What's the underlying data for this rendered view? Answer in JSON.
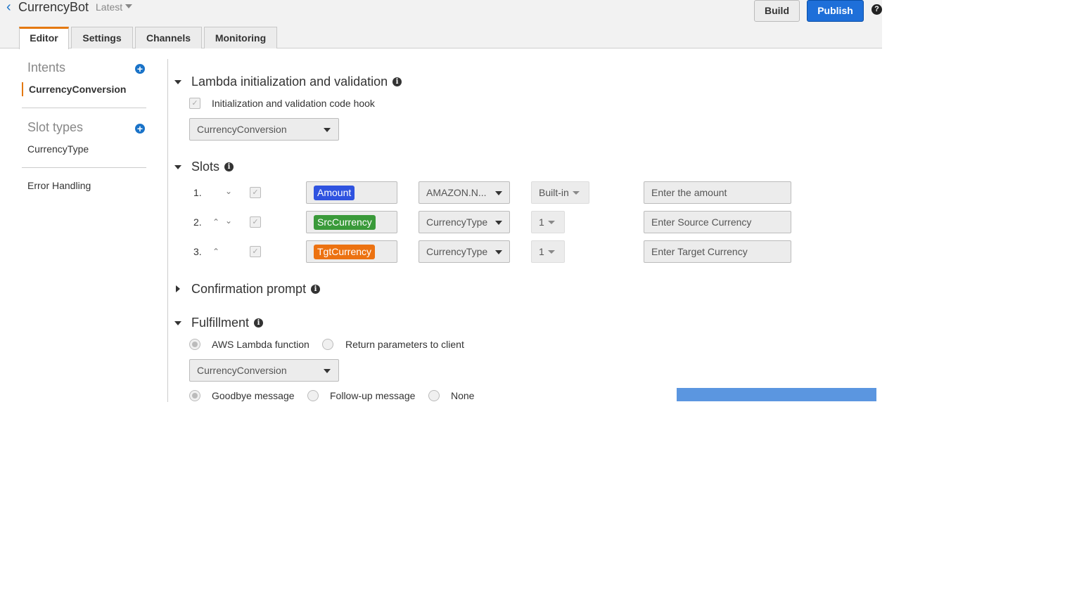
{
  "header": {
    "app_title": "CurrencyBot",
    "version": "Latest",
    "build_label": "Build",
    "publish_label": "Publish",
    "help_symbol": "?"
  },
  "tabs": [
    {
      "label": "Editor",
      "active": true
    },
    {
      "label": "Settings",
      "active": false
    },
    {
      "label": "Channels",
      "active": false
    },
    {
      "label": "Monitoring",
      "active": false
    }
  ],
  "sidebar": {
    "intents_heading": "Intents",
    "intents": [
      "CurrencyConversion"
    ],
    "slot_types_heading": "Slot types",
    "slot_types": [
      "CurrencyType"
    ],
    "error_handling": "Error Handling"
  },
  "lambda_section": {
    "title": "Lambda initialization and validation",
    "hook_label": "Initialization and validation code hook",
    "hook_checked": true,
    "function": "CurrencyConversion"
  },
  "slots_section": {
    "title": "Slots",
    "slots": [
      {
        "index": "1.",
        "name": "Amount",
        "color": "#2f53e0",
        "type": "AMAZON.N...",
        "version": "Built-in",
        "prompt": "Enter the amount",
        "up": false,
        "down": true
      },
      {
        "index": "2.",
        "name": "SrcCurrency",
        "color": "#3a9a3a",
        "type": "CurrencyType",
        "version": "1",
        "prompt": "Enter Source Currency",
        "up": true,
        "down": true
      },
      {
        "index": "3.",
        "name": "TgtCurrency",
        "color": "#ec7211",
        "type": "CurrencyType",
        "version": "1",
        "prompt": "Enter Target Currency",
        "up": true,
        "down": false
      }
    ]
  },
  "confirmation_section": {
    "title": "Confirmation prompt"
  },
  "fulfillment_section": {
    "title": "Fulfillment",
    "options": [
      "AWS Lambda function",
      "Return parameters to client"
    ],
    "selected_option": "AWS Lambda function",
    "function": "CurrencyConversion",
    "message_options": [
      "Goodbye message",
      "Follow-up message",
      "None"
    ],
    "selected_message": "Goodbye message"
  },
  "icons": {
    "back": "chevron-left-icon",
    "add": "plus-circle-icon",
    "info": "info-icon",
    "help": "help-icon"
  },
  "colors": {
    "primary": "#1e6fd9",
    "active_tab_accent": "#e47911",
    "progress_bar": "#5b96e0"
  }
}
